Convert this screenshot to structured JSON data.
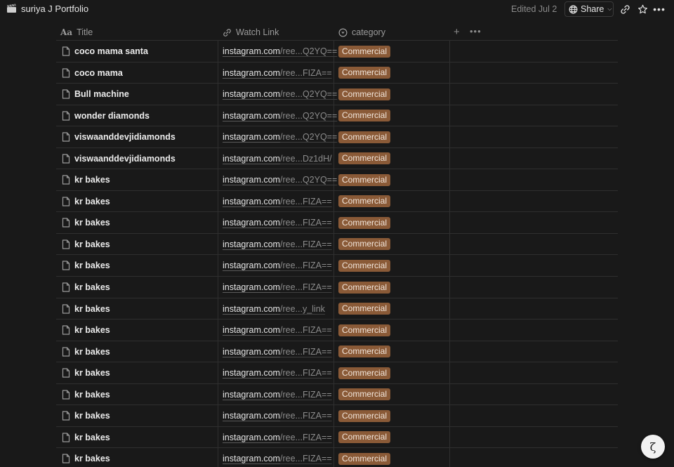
{
  "topbar": {
    "title": "suriya J Portfolio",
    "edited": "Edited Jul 2",
    "share_label": "Share",
    "icons": [
      "clapper-board-icon",
      "globe-icon",
      "link-icon",
      "star-icon",
      "more-icon"
    ]
  },
  "table": {
    "columns": [
      {
        "label": "Title",
        "icon": "text-type-icon"
      },
      {
        "label": "Watch Link",
        "icon": "link-icon"
      },
      {
        "label": "category",
        "icon": "select-icon"
      }
    ],
    "rows": [
      {
        "title": "coco mama santa",
        "domain": "instagram.com",
        "path": "/ree...Q2YQ==",
        "category": "Commercial"
      },
      {
        "title": "coco mama",
        "domain": "instagram.com",
        "path": "/ree...FIZA==",
        "category": "Commercial"
      },
      {
        "title": "Bull machine",
        "domain": "instagram.com",
        "path": "/ree...Q2YQ==",
        "category": "Commercial"
      },
      {
        "title": "wonder diamonds",
        "domain": "instagram.com",
        "path": "/ree...Q2YQ==",
        "category": "Commercial"
      },
      {
        "title": "viswaanddevjidiamonds",
        "domain": "instagram.com",
        "path": "/ree...Q2YQ==",
        "category": "Commercial"
      },
      {
        "title": "viswaanddevjidiamonds",
        "domain": "instagram.com",
        "path": "/ree...Dz1dH/",
        "category": "Commercial"
      },
      {
        "title": "kr bakes",
        "domain": "instagram.com",
        "path": "/ree...Q2YQ==",
        "category": "Commercial"
      },
      {
        "title": "kr bakes",
        "domain": "instagram.com",
        "path": "/ree...FIZA==",
        "category": "Commercial"
      },
      {
        "title": "kr bakes",
        "domain": "instagram.com",
        "path": "/ree...FIZA==",
        "category": "Commercial"
      },
      {
        "title": "kr bakes",
        "domain": "instagram.com",
        "path": "/ree...FIZA==",
        "category": "Commercial"
      },
      {
        "title": "kr bakes",
        "domain": "instagram.com",
        "path": "/ree...FIZA==",
        "category": "Commercial"
      },
      {
        "title": "kr bakes",
        "domain": "instagram.com",
        "path": "/ree...FIZA==",
        "category": "Commercial"
      },
      {
        "title": "kr bakes",
        "domain": "instagram.com",
        "path": "/ree...y_link",
        "category": "Commercial"
      },
      {
        "title": "kr bakes",
        "domain": "instagram.com",
        "path": "/ree...FIZA==",
        "category": "Commercial"
      },
      {
        "title": "kr bakes",
        "domain": "instagram.com",
        "path": "/ree...FIZA==",
        "category": "Commercial"
      },
      {
        "title": "kr bakes",
        "domain": "instagram.com",
        "path": "/ree...FIZA==",
        "category": "Commercial"
      },
      {
        "title": "kr bakes",
        "domain": "instagram.com",
        "path": "/ree...FIZA==",
        "category": "Commercial"
      },
      {
        "title": "kr bakes",
        "domain": "instagram.com",
        "path": "/ree...FIZA==",
        "category": "Commercial"
      },
      {
        "title": "kr bakes",
        "domain": "instagram.com",
        "path": "/ree...FIZA==",
        "category": "Commercial"
      },
      {
        "title": "kr bakes",
        "domain": "instagram.com",
        "path": "/ree...FIZA==",
        "category": "Commercial"
      }
    ]
  },
  "colors": {
    "background": "#191919",
    "badge_commercial": "#8a5a37",
    "grid_line": "#2f2f2f"
  },
  "help_icon": "help-icon"
}
